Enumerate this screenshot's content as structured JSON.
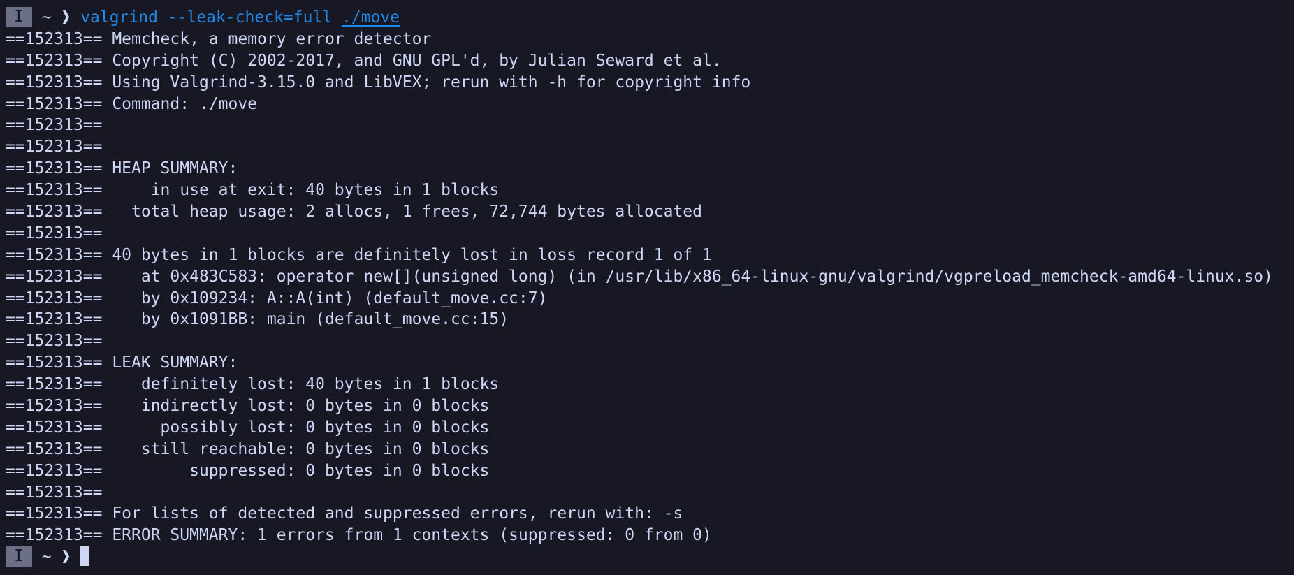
{
  "prompt": {
    "mode_badge": "I",
    "cwd": "~",
    "arrow": "❱",
    "command": "valgrind --leak-check=full",
    "command_arg": "./move"
  },
  "output_lines": [
    "==152313== Memcheck, a memory error detector",
    "==152313== Copyright (C) 2002-2017, and GNU GPL'd, by Julian Seward et al.",
    "==152313== Using Valgrind-3.15.0 and LibVEX; rerun with -h for copyright info",
    "==152313== Command: ./move",
    "==152313==",
    "==152313==",
    "==152313== HEAP SUMMARY:",
    "==152313==     in use at exit: 40 bytes in 1 blocks",
    "==152313==   total heap usage: 2 allocs, 1 frees, 72,744 bytes allocated",
    "==152313==",
    "==152313== 40 bytes in 1 blocks are definitely lost in loss record 1 of 1",
    "==152313==    at 0x483C583: operator new[](unsigned long) (in /usr/lib/x86_64-linux-gnu/valgrind/vgpreload_memcheck-amd64-linux.so)",
    "==152313==    by 0x109234: A::A(int) (default_move.cc:7)",
    "==152313==    by 0x1091BB: main (default_move.cc:15)",
    "==152313==",
    "==152313== LEAK SUMMARY:",
    "==152313==    definitely lost: 40 bytes in 1 blocks",
    "==152313==    indirectly lost: 0 bytes in 0 blocks",
    "==152313==      possibly lost: 0 bytes in 0 blocks",
    "==152313==    still reachable: 0 bytes in 0 blocks",
    "==152313==         suppressed: 0 bytes in 0 blocks",
    "==152313==",
    "==152313== For lists of detected and suppressed errors, rerun with: -s",
    "==152313== ERROR SUMMARY: 1 errors from 1 contexts (suppressed: 0 from 0)"
  ],
  "prompt_end": {
    "mode_badge": "I",
    "cwd": "~",
    "arrow": "❱"
  },
  "colors": {
    "background": "#181825",
    "foreground": "#cdd6f4",
    "command": "#1e88e5",
    "badge": "#6c7086"
  }
}
